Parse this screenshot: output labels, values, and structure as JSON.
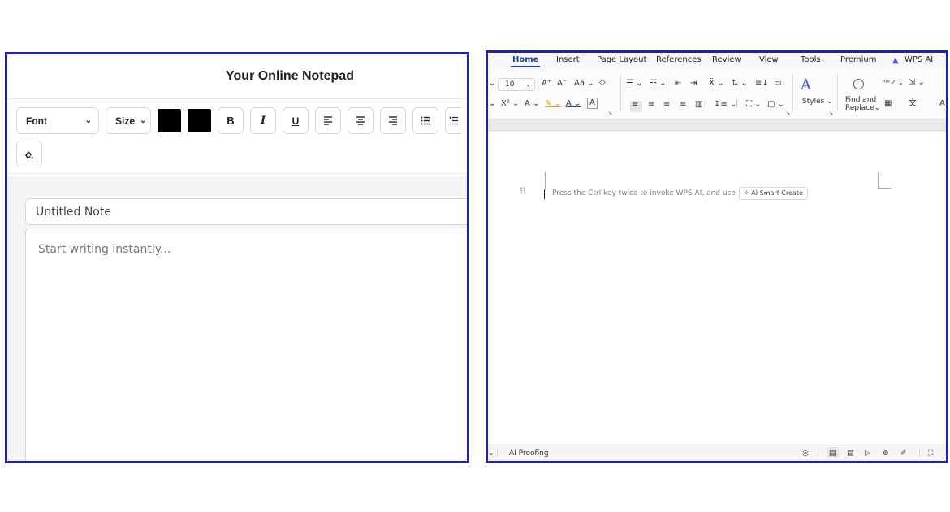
{
  "notepad": {
    "title": "Your Online Notepad",
    "font_label": "Font",
    "size_label": "Size",
    "text_color": "#000000",
    "highlight_color": "#000000",
    "bold": "B",
    "italic": "I",
    "underline": "U",
    "note_title_value": "Untitled Note",
    "editor_placeholder": "Start writing instantly..."
  },
  "wps": {
    "tabs": [
      "Home",
      "Insert",
      "Page Layout",
      "References",
      "Review",
      "View",
      "Tools",
      "Premium",
      "WPS AI"
    ],
    "active_tab": "Home",
    "font_size": "10",
    "styles_label": "Styles",
    "find_label_1": "Find and",
    "find_label_2": "Replace",
    "hint_text": "Press the Ctrl key twice to invoke WPS AI, and use",
    "smart_create": "AI Smart Create",
    "status_proofing": "AI Proofing",
    "accent_color": "#1a3e9e",
    "frame_color": "#1f22a8"
  }
}
